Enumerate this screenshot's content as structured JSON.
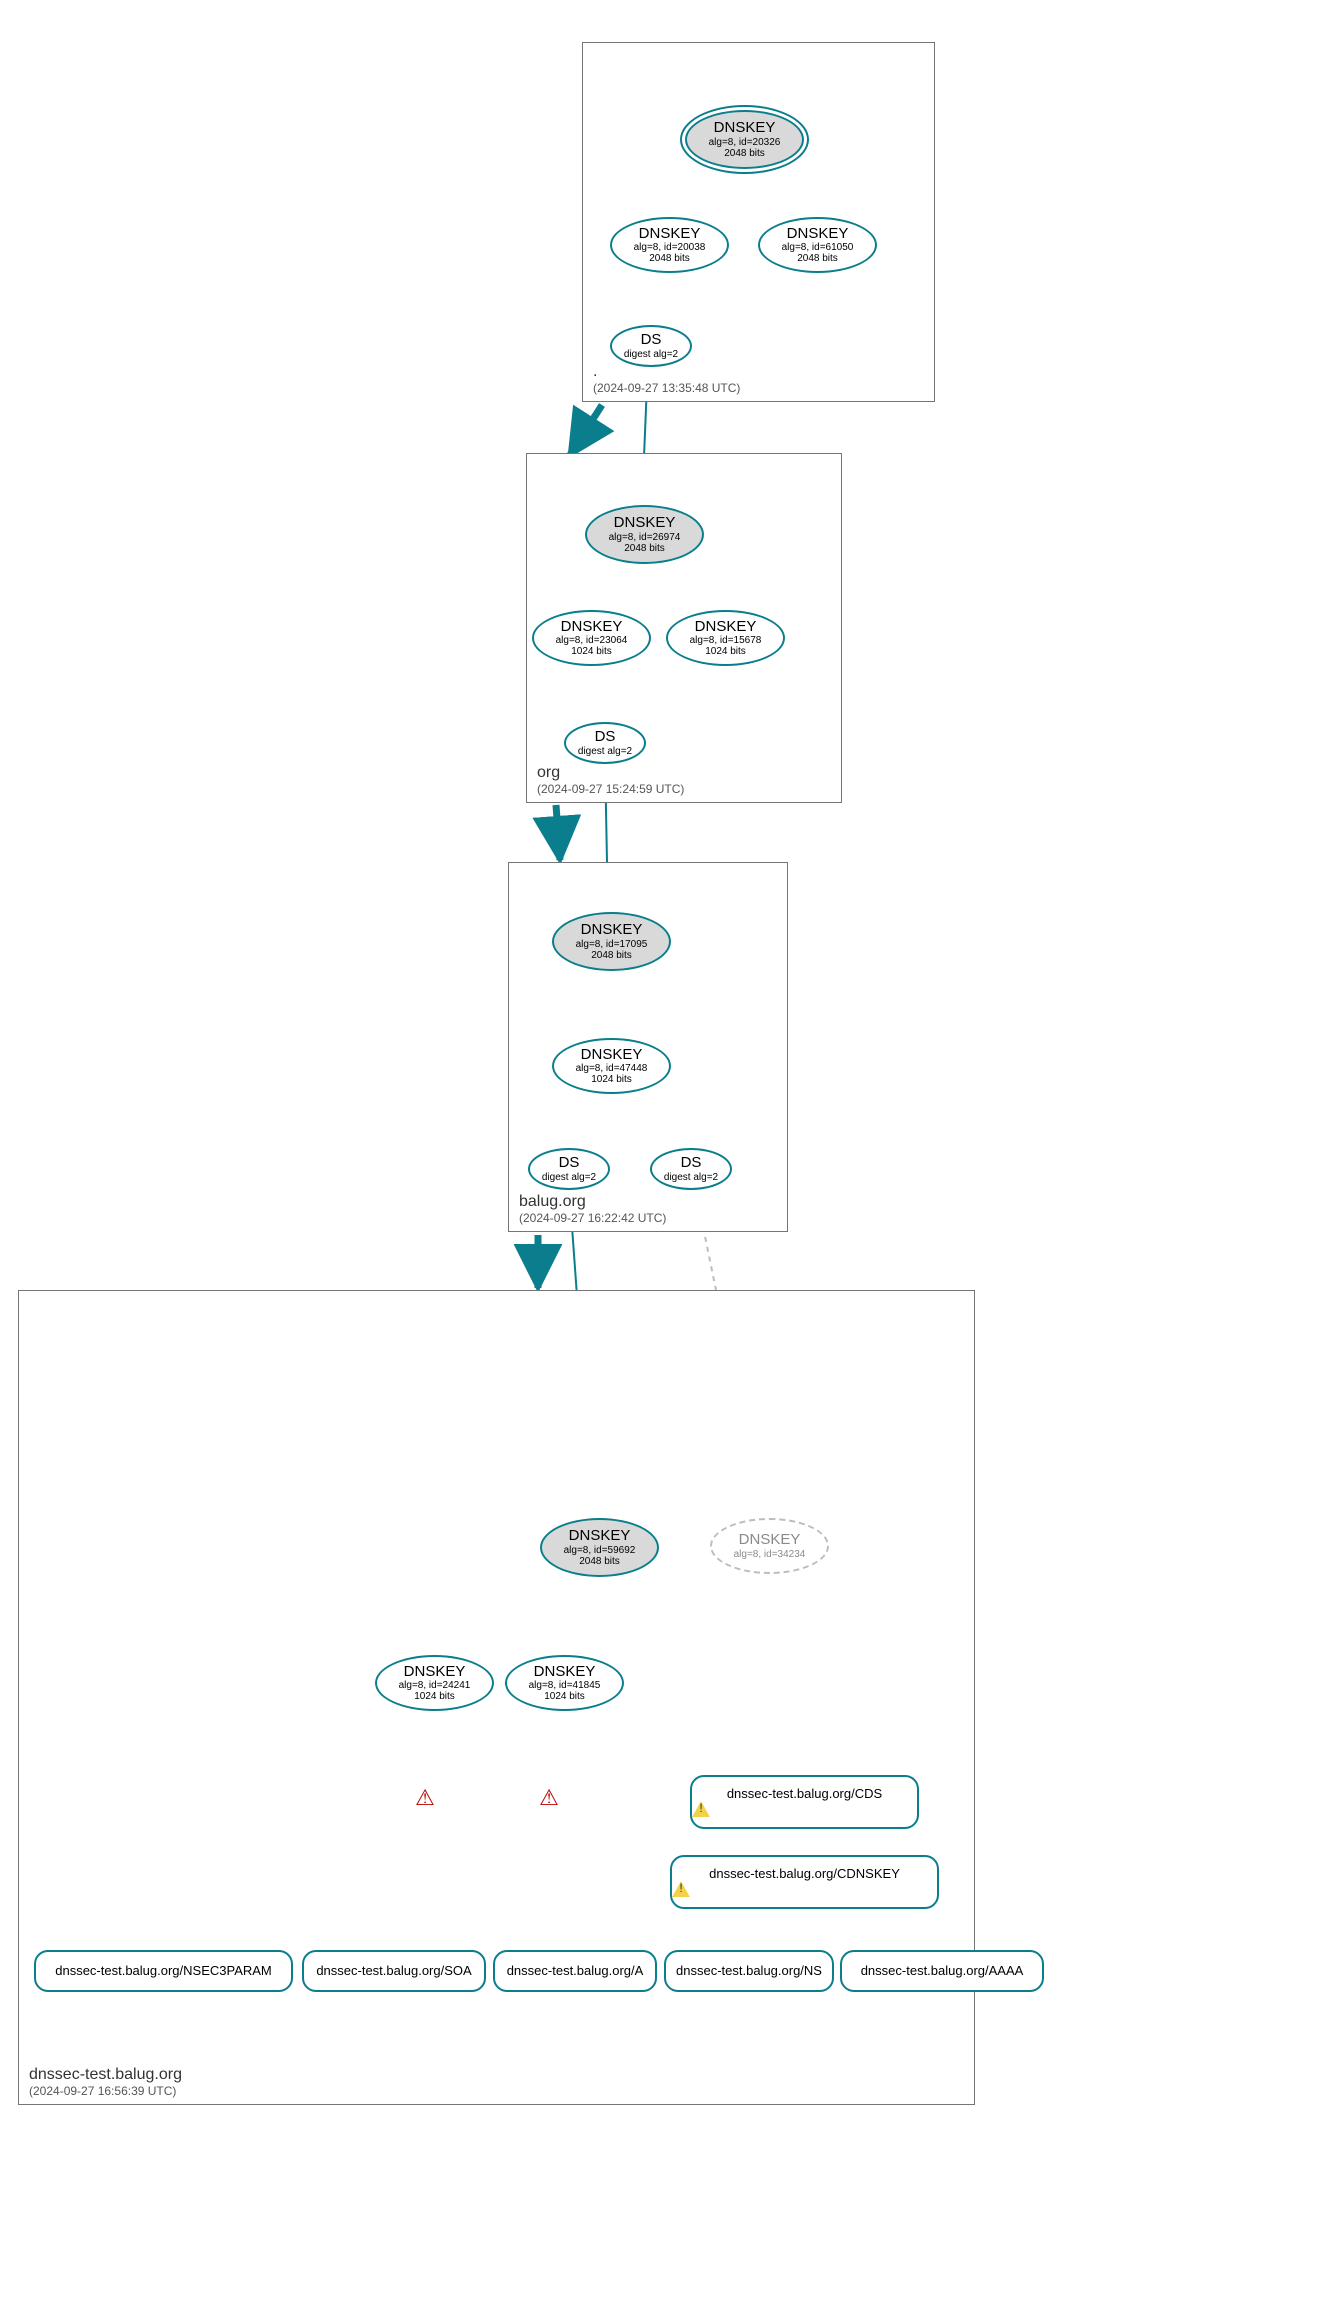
{
  "zones": {
    "root": {
      "title": ".",
      "time": "(2024-09-27 13:35:48 UTC)"
    },
    "org": {
      "title": "org",
      "time": "(2024-09-27 15:24:59 UTC)"
    },
    "balug": {
      "title": "balug.org",
      "time": "(2024-09-27 16:22:42 UTC)"
    },
    "dnssec": {
      "title": "dnssec-test.balug.org",
      "time": "(2024-09-27 16:56:39 UTC)"
    }
  },
  "nodes": {
    "root_ksk": {
      "l1": "DNSKEY",
      "l2": "alg=8, id=20326",
      "l3": "2048 bits"
    },
    "root_zsk1": {
      "l1": "DNSKEY",
      "l2": "alg=8, id=20038",
      "l3": "2048 bits"
    },
    "root_zsk2": {
      "l1": "DNSKEY",
      "l2": "alg=8, id=61050",
      "l3": "2048 bits"
    },
    "root_ds": {
      "l1": "DS",
      "l2": "digest alg=2",
      "l3": ""
    },
    "org_ksk": {
      "l1": "DNSKEY",
      "l2": "alg=8, id=26974",
      "l3": "2048 bits"
    },
    "org_zsk1": {
      "l1": "DNSKEY",
      "l2": "alg=8, id=23064",
      "l3": "1024 bits"
    },
    "org_zsk2": {
      "l1": "DNSKEY",
      "l2": "alg=8, id=15678",
      "l3": "1024 bits"
    },
    "org_ds": {
      "l1": "DS",
      "l2": "digest alg=2",
      "l3": ""
    },
    "balug_ksk": {
      "l1": "DNSKEY",
      "l2": "alg=8, id=17095",
      "l3": "2048 bits"
    },
    "balug_zsk": {
      "l1": "DNSKEY",
      "l2": "alg=8, id=47448",
      "l3": "1024 bits"
    },
    "balug_ds1": {
      "l1": "DS",
      "l2": "digest alg=2",
      "l3": ""
    },
    "balug_ds2": {
      "l1": "DS",
      "l2": "digest alg=2",
      "l3": ""
    },
    "dnssec_ksk": {
      "l1": "DNSKEY",
      "l2": "alg=8, id=59692",
      "l3": "2048 bits"
    },
    "dnssec_extra": {
      "l1": "DNSKEY",
      "l2": "alg=8, id=34234",
      "l3": ""
    },
    "dnssec_zsk1": {
      "l1": "DNSKEY",
      "l2": "alg=8, id=24241",
      "l3": "1024 bits"
    },
    "dnssec_zsk2": {
      "l1": "DNSKEY",
      "l2": "alg=8, id=41845",
      "l3": "1024 bits"
    },
    "rr_cds": {
      "l1": "dnssec-test.balug.org/CDS"
    },
    "rr_cdnskey": {
      "l1": "dnssec-test.balug.org/CDNSKEY"
    },
    "rr_nsec3": {
      "l1": "dnssec-test.balug.org/NSEC3PARAM"
    },
    "rr_soa": {
      "l1": "dnssec-test.balug.org/SOA"
    },
    "rr_a": {
      "l1": "dnssec-test.balug.org/A"
    },
    "rr_ns": {
      "l1": "dnssec-test.balug.org/NS"
    },
    "rr_aaaa": {
      "l1": "dnssec-test.balug.org/AAAA"
    }
  },
  "warning_glyph": "⚠"
}
